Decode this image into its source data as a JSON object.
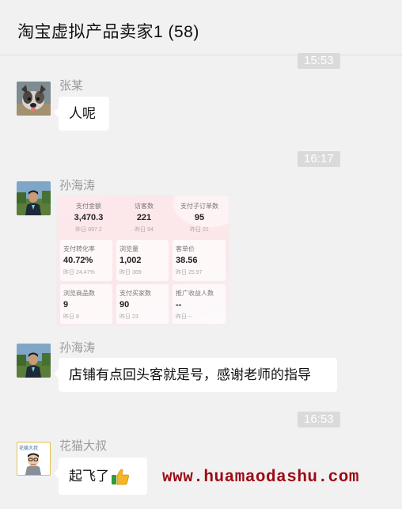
{
  "header": {
    "title": "淘宝虚拟产品卖家1 (58)"
  },
  "timestamps": [
    "15:53",
    "16:17",
    "16:53"
  ],
  "messages": [
    {
      "sender": "张某",
      "text": "人呢"
    },
    {
      "sender": "孙海涛",
      "type": "image"
    },
    {
      "sender": "孙海涛",
      "text": "店铺有点回头客就是号，感谢老师的指导"
    },
    {
      "sender": "花猫大叔",
      "text": "起飞了"
    }
  ],
  "stats_image": {
    "top": [
      {
        "label": "支付金额",
        "value": "3,470.3",
        "sub": "昨日 897.2"
      },
      {
        "label": "访客数",
        "value": "221",
        "sub": "昨日 94"
      },
      {
        "label": "支付子订单数",
        "value": "95",
        "sub": "昨日 21"
      }
    ],
    "grid": [
      {
        "label": "支付转化率",
        "value": "40.72%",
        "sub": "昨日 24.47%"
      },
      {
        "label": "浏览量",
        "value": "1,002",
        "sub": "昨日 369"
      },
      {
        "label": "客单价",
        "value": "38.56",
        "sub": "昨日 25.97"
      },
      {
        "label": "浏览商品数",
        "value": "9",
        "sub": "昨日 8"
      },
      {
        "label": "支付买家数",
        "value": "90",
        "sub": "昨日 23"
      },
      {
        "label": "推广收益人数",
        "value": "--",
        "sub": "昨日 --"
      }
    ]
  },
  "avatar_caption": "花猫大叔",
  "watermark": "www.huamaodashu.com",
  "colors": {
    "background": "#f1f1f1",
    "bubble": "#ffffff",
    "timestamp_bg": "#dadada",
    "watermark": "#9b0a15"
  }
}
